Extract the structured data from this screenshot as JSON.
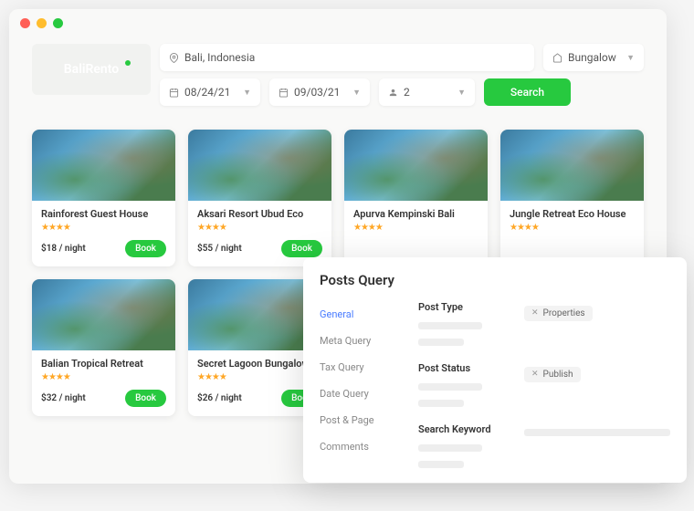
{
  "logo": "BaliRento",
  "search": {
    "location": "Bali, Indonesia",
    "property_type": "Bungalow",
    "checkin": "08/24/21",
    "checkout": "09/03/21",
    "guests": "2",
    "button": "Search"
  },
  "listings": [
    {
      "title": "Rainforest Guest House",
      "stars": "★★★★",
      "price": "$18 / night",
      "book": "Book"
    },
    {
      "title": "Aksari Resort Ubud Eco",
      "stars": "★★★★",
      "price": "$55 / night",
      "book": "Book"
    },
    {
      "title": "Apurva Kempinski Bali",
      "stars": "★★★★",
      "price": "",
      "book": ""
    },
    {
      "title": "Jungle Retreat Eco House",
      "stars": "★★★★",
      "price": "",
      "book": ""
    },
    {
      "title": "Balian Tropical Retreat",
      "stars": "★★★★",
      "price": "$32 / night",
      "book": "Book"
    },
    {
      "title": "Secret Lagoon Bungalow",
      "stars": "★★★★",
      "price": "$26 / night",
      "book": "Book"
    }
  ],
  "panel": {
    "title": "Posts Query",
    "tabs": [
      "General",
      "Meta Query",
      "Tax Query",
      "Date Query",
      "Post & Page",
      "Comments"
    ],
    "active_tab": 0,
    "rows": [
      {
        "label": "Post Type",
        "chip": "Properties"
      },
      {
        "label": "Post Status",
        "chip": "Publish"
      },
      {
        "label": "Search Keyword",
        "chip": ""
      }
    ]
  }
}
